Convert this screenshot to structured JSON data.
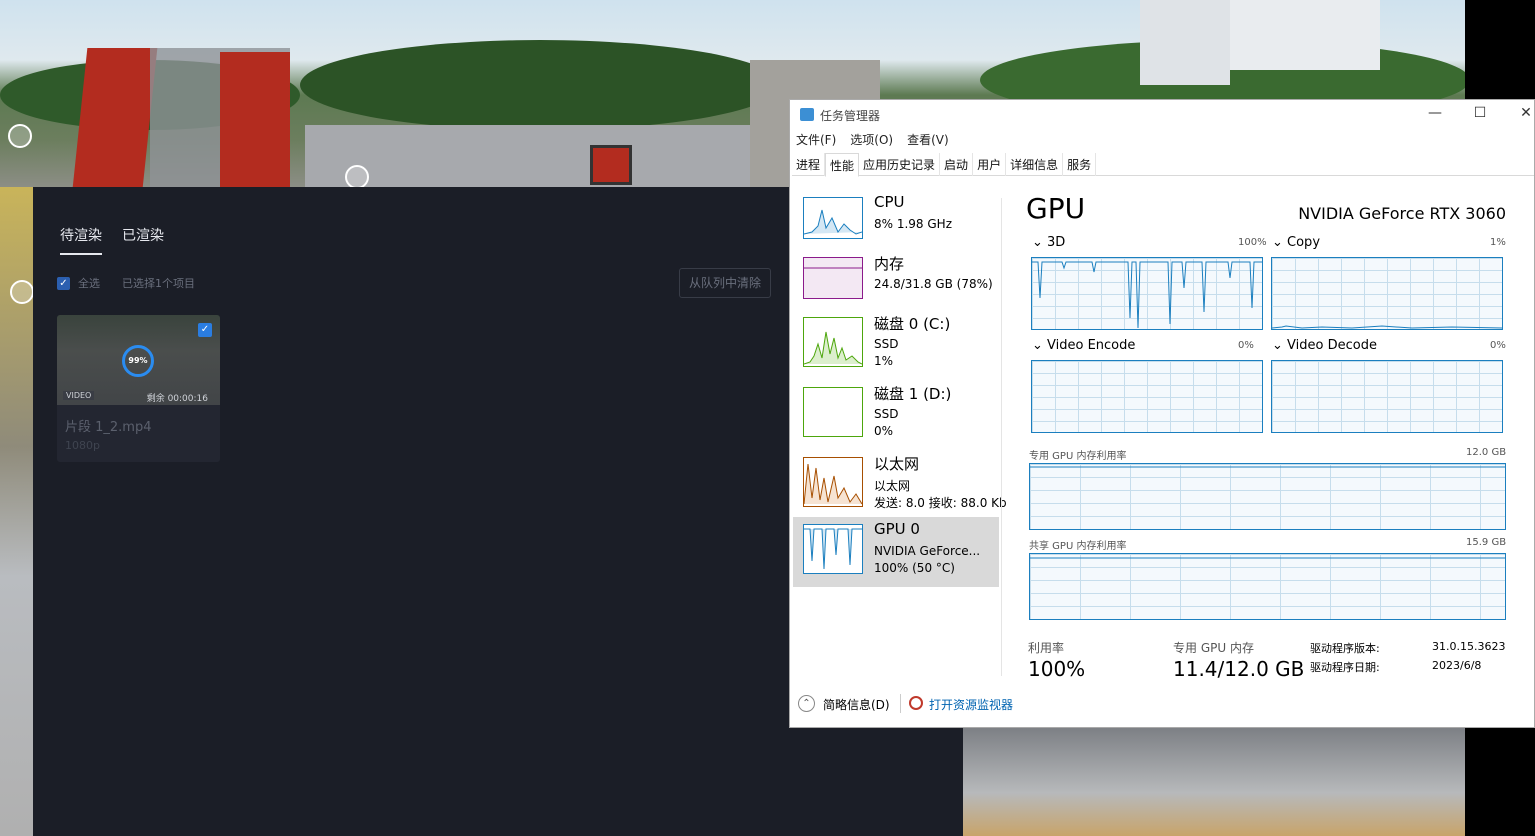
{
  "renderer": {
    "tabs": [
      "待渲染",
      "已渲染"
    ],
    "select_all": "全选",
    "selected_count": "已选择1个项目",
    "clear_button": "从队列中清除",
    "card": {
      "progress": "99%",
      "badge": "VIDEO",
      "remaining": "剩余 00:00:16",
      "title": "片段 1_2.mp4",
      "resolution": "1080p"
    }
  },
  "task_manager": {
    "title": "任务管理器",
    "window_controls": [
      "—",
      "☐",
      "✕"
    ],
    "menu": [
      "文件(F)",
      "选项(O)",
      "查看(V)"
    ],
    "tabs": [
      "进程",
      "性能",
      "应用历史记录",
      "启动",
      "用户",
      "详细信息",
      "服务"
    ],
    "active_tab": "性能",
    "resources": [
      {
        "name": "CPU",
        "l2": "8% 1.98 GHz",
        "l3": "",
        "color": "#1b7fbf"
      },
      {
        "name": "内存",
        "l2": "24.8/31.8 GB (78%)",
        "l3": "",
        "color": "#8b1a8b"
      },
      {
        "name": "磁盘 0 (C:)",
        "l2": "SSD",
        "l3": "1%",
        "color": "#4da60c"
      },
      {
        "name": "磁盘 1 (D:)",
        "l2": "SSD",
        "l3": "0%",
        "color": "#4da60c"
      },
      {
        "name": "以太网",
        "l2": "以太网",
        "l3": "发送: 8.0 接收: 88.0 Kb",
        "color": "#a74f01"
      },
      {
        "name": "GPU 0",
        "l2": "NVIDIA GeForce...",
        "l3": "100% (50 °C)",
        "color": "#1b7fbf"
      }
    ],
    "gpu": {
      "title": "GPU",
      "model": "NVIDIA GeForce RTX 3060",
      "engines": [
        {
          "label": "3D",
          "pct": "100%"
        },
        {
          "label": "Copy",
          "pct": "1%"
        },
        {
          "label": "Video Encode",
          "pct": "0%"
        },
        {
          "label": "Video Decode",
          "pct": "0%"
        }
      ],
      "dedicated_mem_label": "专用 GPU 内存利用率",
      "dedicated_mem_max": "12.0 GB",
      "shared_mem_label": "共享 GPU 内存利用率",
      "shared_mem_max": "15.9 GB",
      "util_label": "利用率",
      "util_value": "100%",
      "ded_label": "专用 GPU 内存",
      "ded_value": "11.4/12.0 GB",
      "driver_version_label": "驱动程序版本:",
      "driver_version": "31.0.15.3623",
      "driver_date_label": "驱动程序日期:",
      "driver_date": "2023/6/8"
    },
    "footer": {
      "brief": "简略信息(D)",
      "open_monitor": "打开资源监视器"
    }
  }
}
